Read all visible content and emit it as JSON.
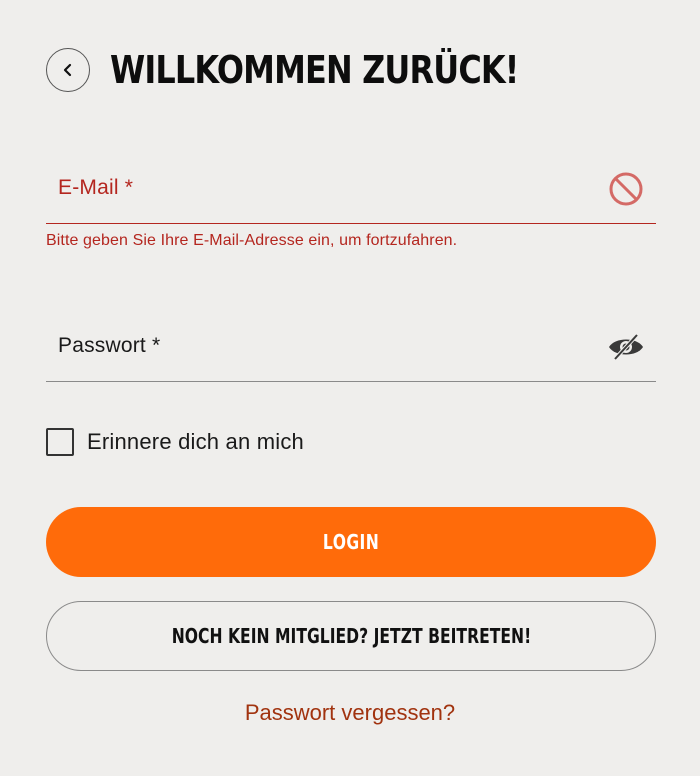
{
  "header": {
    "title": "WILLKOMMEN ZURÜCK!",
    "back_icon": "chevron-left-icon"
  },
  "form": {
    "email": {
      "label": "E-Mail *",
      "value": "",
      "error": "Bitte geben Sie Ihre E-Mail-Adresse ein, um fortzufahren.",
      "status_icon": "invalid-icon"
    },
    "password": {
      "label": "Passwort *",
      "value": "",
      "visibility_icon": "eye-slash-icon"
    },
    "remember": {
      "label": "Erinnere dich an mich",
      "checked": false
    }
  },
  "buttons": {
    "login": "LOGIN",
    "join": "NOCH KEIN MITGLIED? JETZT BEITRETEN!"
  },
  "links": {
    "forgot_password": "Passwort vergessen?"
  },
  "colors": {
    "background": "#efeeec",
    "accent_orange": "#ff6b0a",
    "error_red": "#b4261f",
    "link": "#a1330f"
  }
}
